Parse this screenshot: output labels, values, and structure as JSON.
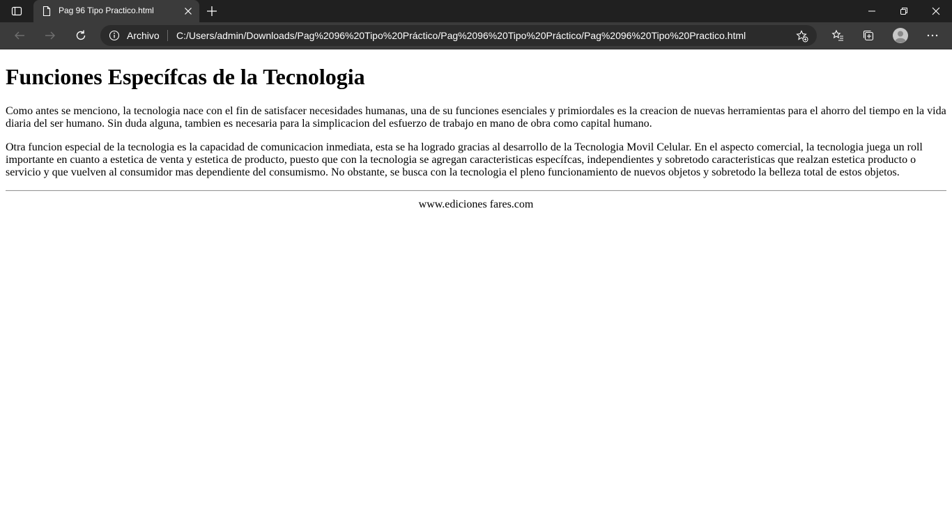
{
  "browser": {
    "tab": {
      "title": "Pag 96 Tipo Practico.html"
    },
    "address_bar": {
      "scheme_label": "Archivo",
      "url": "C:/Users/admin/Downloads/Pag%2096%20Tipo%20Práctico/Pag%2096%20Tipo%20Práctico/Pag%2096%20Tipo%20Practico.html"
    },
    "icons": [
      "tab-actions-icon",
      "page-icon",
      "close-icon",
      "plus-icon",
      "minimize-icon",
      "restore-icon",
      "close-window-icon",
      "back-arrow-icon",
      "forward-arrow-icon",
      "reload-icon",
      "info-icon",
      "favorite-add-icon",
      "favorites-icon",
      "collections-icon",
      "profile-icon",
      "more-icon"
    ]
  },
  "page": {
    "heading": "Funciones Específcas de la Tecnologia",
    "paragraphs": [
      "Como antes se menciono, la tecnologia nace con el fin de satisfacer necesidades humanas, una de su funciones esenciales y primiordales es la creacion de nuevas herramientas para el ahorro del tiempo en la vida diaria del ser humano. Sin duda alguna, tambien es necesaria para la simplicacion del esfuerzo de trabajo en mano de obra como capital humano.",
      "Otra funcion especial de la tecnologia es la capacidad de comunicacion inmediata, esta se ha logrado gracias al desarrollo de la Tecnologia Movil Celular. En el aspecto comercial, la tecnologia juega un roll importante en cuanto a estetica de venta y estetica de producto, puesto que con la tecnologia se agregan caracteristicas específcas, independientes y sobretodo caracteristicas que realzan estetica producto o servicio y que vuelven al consumidor mas dependiente del consumismo. No obstante, se busca con la tecnologia el pleno funcionamiento de nuevos objetos y sobretodo la belleza total de estos objetos."
    ],
    "footer": "www.ediciones fares.com"
  }
}
